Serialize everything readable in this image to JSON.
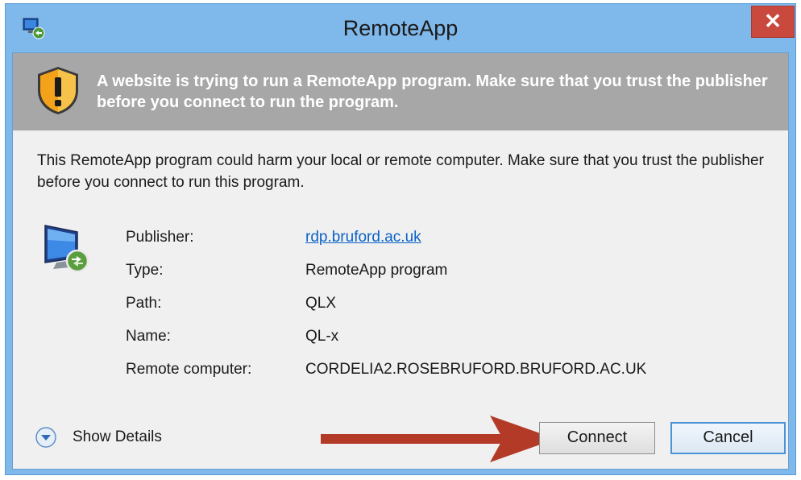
{
  "window": {
    "title": "RemoteApp",
    "close_label": "✕",
    "accent_color": "#7fb8ea",
    "close_color": "#c9493f"
  },
  "banner": {
    "icon": "warning-shield-icon",
    "message": "A website is trying to run a RemoteApp program. Make sure that you trust the publisher before you connect to run the program."
  },
  "warning": {
    "text": "This RemoteApp program could harm your local or remote computer. Make sure that you trust the publisher before you connect to run this program."
  },
  "details": {
    "icon": "remote-computer-icon",
    "rows": [
      {
        "label": "Publisher:",
        "value": "rdp.bruford.ac.uk"
      },
      {
        "label": "Type:",
        "value": "RemoteApp program"
      },
      {
        "label": "Path:",
        "value": "QLX"
      },
      {
        "label": "Name:",
        "value": "QL-x"
      },
      {
        "label": "Remote computer:",
        "value": "CORDELIA2.ROSEBRUFORD.BRUFORD.AC.UK"
      }
    ]
  },
  "footer": {
    "show_details_label": "Show Details",
    "connect_label": "Connect",
    "cancel_label": "Cancel",
    "annotation_arrow_color": "#b33a26"
  }
}
